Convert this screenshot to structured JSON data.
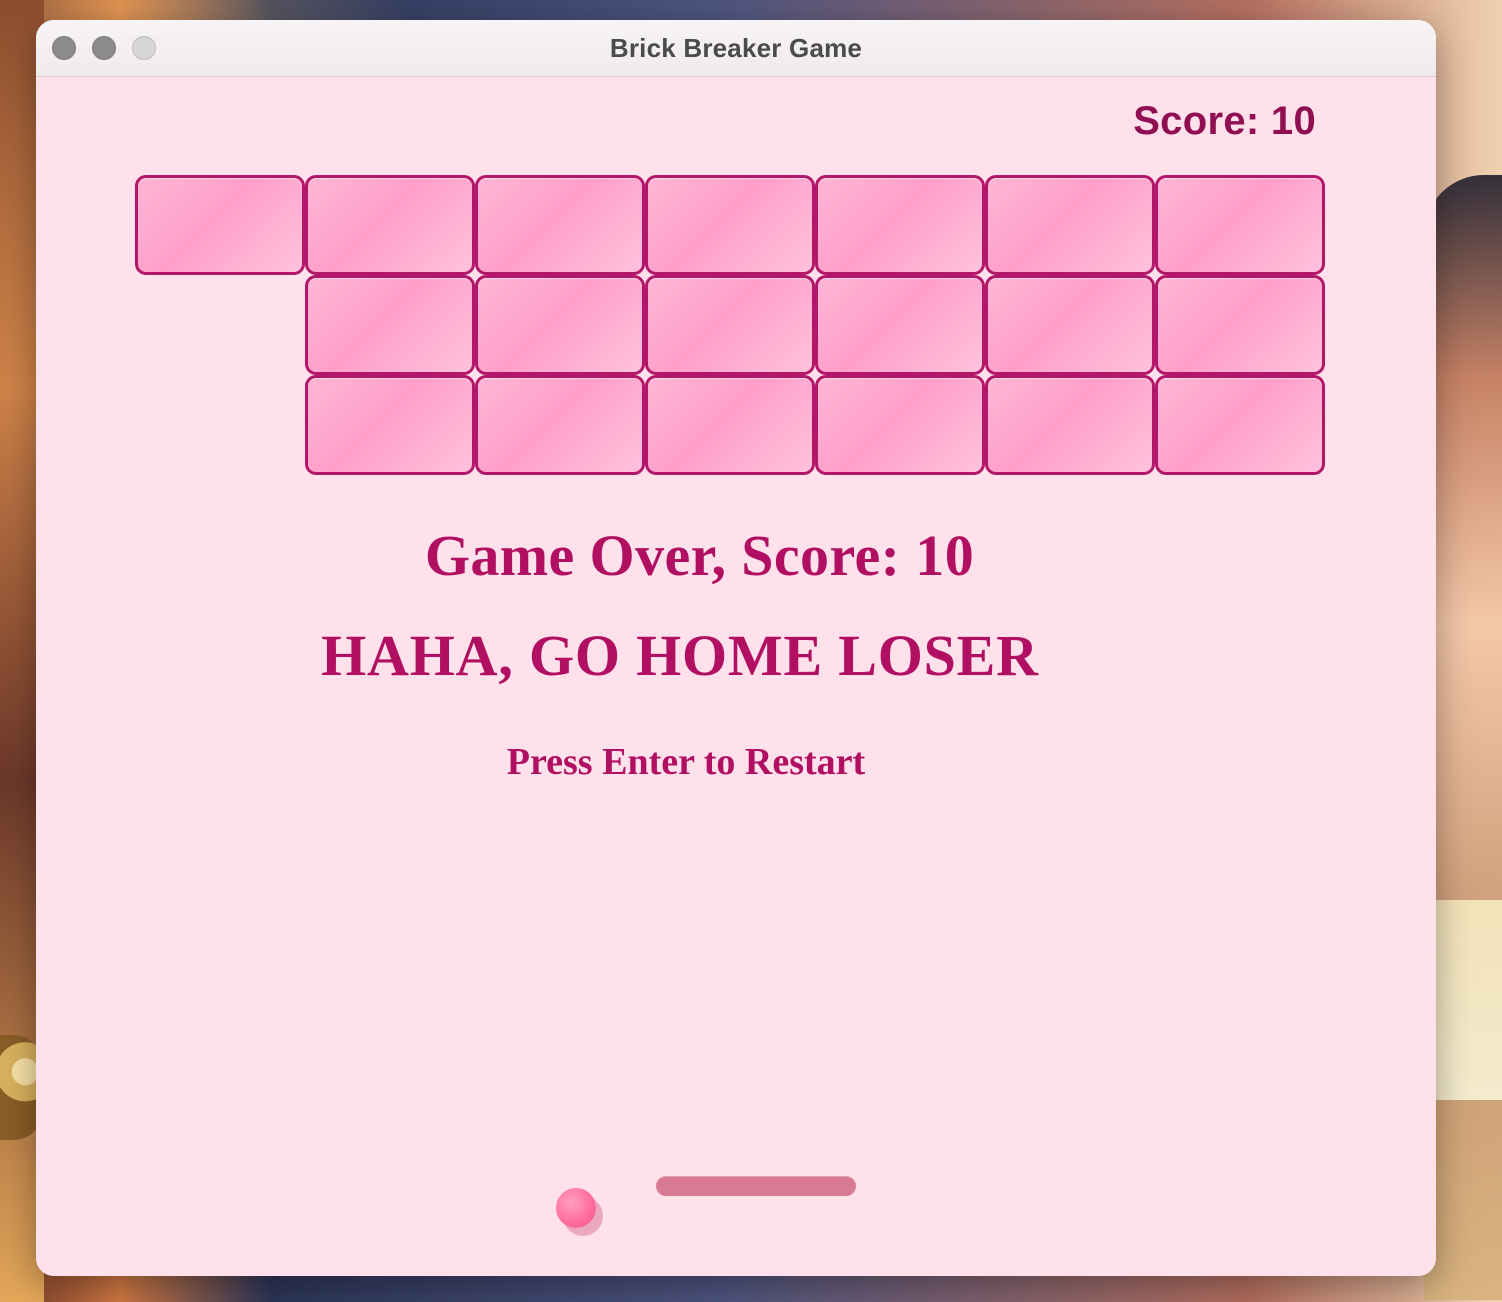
{
  "window": {
    "title": "Brick Breaker Game"
  },
  "game": {
    "score_label": "Score: 10",
    "messages": {
      "game_over": "Game Over, Score: 10",
      "taunt": "HAHA, GO HOME LOSER",
      "restart": "Press Enter to Restart"
    },
    "brick_grid": {
      "rows": [
        [
          true,
          true,
          true,
          true,
          true,
          true,
          true
        ],
        [
          false,
          true,
          true,
          true,
          true,
          true,
          true
        ],
        [
          false,
          true,
          true,
          true,
          true,
          true,
          true
        ]
      ]
    }
  },
  "colors": {
    "background": "#ffe1eb",
    "score": "#8f0f52",
    "message": "#b00f62",
    "brick_border": "#b2176a",
    "brick_fill": "#ff9fc9",
    "paddle": "#d97a94",
    "ball": "#ff6f9f"
  },
  "icons": {
    "close": "traffic-light-close-icon",
    "minimize": "traffic-light-minimize-icon",
    "maximize": "traffic-light-maximize-icon"
  }
}
